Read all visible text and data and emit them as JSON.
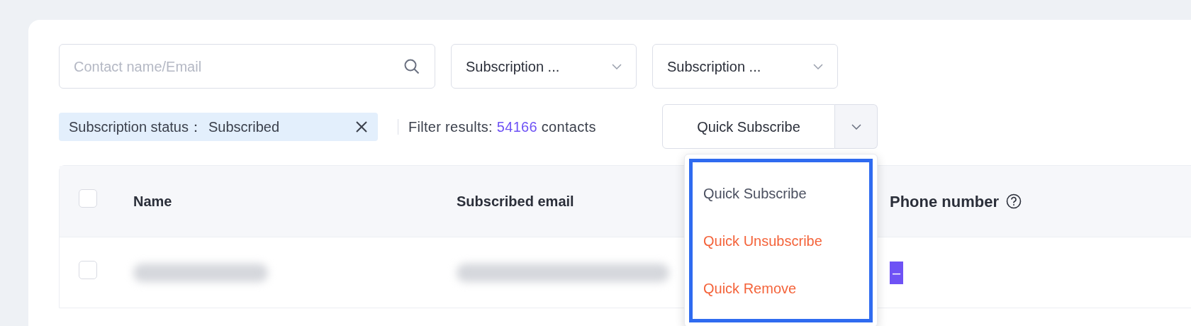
{
  "search": {
    "placeholder": "Contact name/Email"
  },
  "filters": [
    {
      "label": "Subscription ..."
    },
    {
      "label": "Subscription ..."
    }
  ],
  "active_filter": {
    "label": "Subscription status：",
    "value": "Subscribed"
  },
  "results": {
    "prefix": "Filter results:",
    "count": "54166",
    "suffix": "contacts"
  },
  "split_button": {
    "label": "Quick Subscribe",
    "expanded": true
  },
  "menu": [
    {
      "label": "Quick Subscribe",
      "kind": "normal"
    },
    {
      "label": "Quick Unsubscribe",
      "kind": "danger"
    },
    {
      "label": "Quick Remove",
      "kind": "danger"
    }
  ],
  "table": {
    "columns": [
      "Name",
      "Subscribed email",
      "Phone number"
    ],
    "rows": [
      {
        "checked": false,
        "phone": "–"
      }
    ]
  },
  "header_checked": false
}
